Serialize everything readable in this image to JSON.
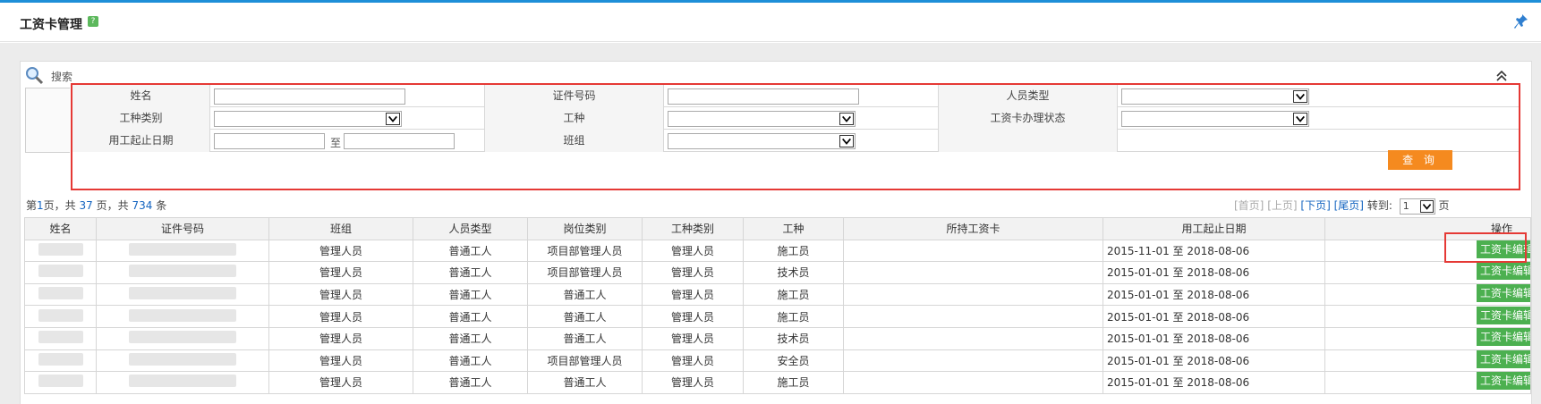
{
  "header": {
    "title": "工资卡管理",
    "help": "?"
  },
  "search": {
    "label": "搜索",
    "fields": {
      "name_label": "姓名",
      "id_label": "证件号码",
      "person_type_label": "人员类型",
      "worktype_cat_label": "工种类别",
      "worktype_label": "工种",
      "card_status_label": "工资卡办理状态",
      "date_label": "用工起止日期",
      "date_to": "至",
      "team_label": "班组"
    },
    "query_button": "查 询"
  },
  "pager": {
    "page_prefix": "第",
    "current_page": "1",
    "page_mid": "页，共",
    "total_pages": "37",
    "page_mid2": "页，共",
    "total_records": "734",
    "record_suffix": "条",
    "first": "[首页]",
    "prev": "[上页]",
    "next": "[下页]",
    "last": "[尾页]",
    "goto": "转到:",
    "goto_value": "1",
    "goto_suffix": "页"
  },
  "table": {
    "columns": [
      "姓名",
      "证件号码",
      "班组",
      "人员类型",
      "岗位类别",
      "工种类别",
      "工种",
      "所持工资卡",
      "用工起止日期",
      "操作"
    ],
    "rows": [
      {
        "team": "管理人员",
        "person_type": "普通工人",
        "post": "项目部管理人员",
        "worktype_cat": "管理人员",
        "worktype": "施工员",
        "card": "",
        "date": "2015-11-01 至 2018-08-06",
        "action": "工资卡编辑"
      },
      {
        "team": "管理人员",
        "person_type": "普通工人",
        "post": "项目部管理人员",
        "worktype_cat": "管理人员",
        "worktype": "技术员",
        "card": "",
        "date": "2015-01-01 至 2018-08-06",
        "action": "工资卡编辑"
      },
      {
        "team": "管理人员",
        "person_type": "普通工人",
        "post": "普通工人",
        "worktype_cat": "管理人员",
        "worktype": "施工员",
        "card": "",
        "date": "2015-01-01 至 2018-08-06",
        "action": "工资卡编辑"
      },
      {
        "team": "管理人员",
        "person_type": "普通工人",
        "post": "普通工人",
        "worktype_cat": "管理人员",
        "worktype": "施工员",
        "card": "",
        "date": "2015-01-01 至 2018-08-06",
        "action": "工资卡编辑"
      },
      {
        "team": "管理人员",
        "person_type": "普通工人",
        "post": "普通工人",
        "worktype_cat": "管理人员",
        "worktype": "技术员",
        "card": "",
        "date": "2015-01-01 至 2018-08-06",
        "action": "工资卡编辑"
      },
      {
        "team": "管理人员",
        "person_type": "普通工人",
        "post": "项目部管理人员",
        "worktype_cat": "管理人员",
        "worktype": "安全员",
        "card": "",
        "date": "2015-01-01 至 2018-08-06",
        "action": "工资卡编辑"
      },
      {
        "team": "管理人员",
        "person_type": "普通工人",
        "post": "普通工人",
        "worktype_cat": "管理人员",
        "worktype": "施工员",
        "card": "",
        "date": "2015-01-01 至 2018-08-06",
        "action": "工资卡编辑"
      }
    ]
  },
  "colors": {
    "accent": "#1e8fd8",
    "query": "#f58a1f",
    "edit": "#4cb050",
    "highlight": "#e53935"
  }
}
